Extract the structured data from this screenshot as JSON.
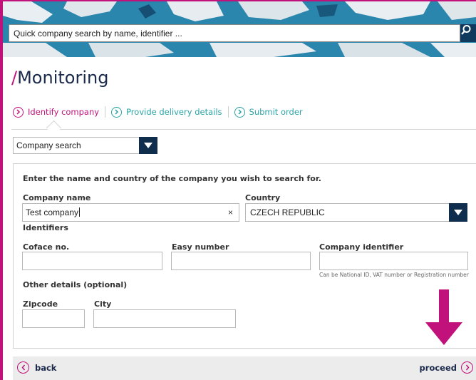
{
  "search": {
    "placeholder": "Quick company search by name, identifier ..."
  },
  "page": {
    "slash": "/",
    "title": "Monitoring"
  },
  "steps": [
    {
      "label": "Identify company"
    },
    {
      "label": "Provide delivery details"
    },
    {
      "label": "Submit order"
    }
  ],
  "search_type": {
    "selected": "Company search"
  },
  "form": {
    "intro": "Enter the name and country of the company you wish to search for.",
    "company_name_label": "Company name",
    "company_name_value": "Test company",
    "clear_symbol": "×",
    "country_label": "Country",
    "country_value": "CZECH REPUBLIC",
    "identifiers_label": "Identifiers",
    "coface_label": "Coface no.",
    "easy_label": "Easy number",
    "company_id_label": "Company identifier",
    "company_id_hint": "Can be National ID, VAT number or Registration number",
    "other_label": "Other details (optional)",
    "zipcode_label": "Zipcode",
    "city_label": "City"
  },
  "footer": {
    "back_label": "back",
    "proceed_label": "proceed"
  },
  "colors": {
    "accent": "#c0127a",
    "teal": "#2aa3a5",
    "navy": "#0f2d4d"
  }
}
